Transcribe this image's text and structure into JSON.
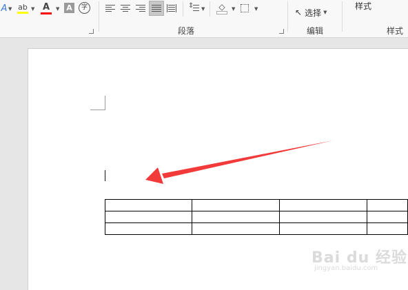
{
  "ribbon": {
    "font_group": {
      "text_effects_icon": "A",
      "highlight_icon": "ab",
      "font_color_icon": "A",
      "char_shading_icon": "A",
      "enclose_char_icon": "字"
    },
    "paragraph_group": {
      "label": "段落"
    },
    "editing_group": {
      "select_label": "选择",
      "label": "编辑"
    },
    "styles_group": {
      "gallery_label": "样式",
      "label": "样式"
    },
    "colors": {
      "highlight": "#ffff00",
      "font_color": "#ff0000"
    }
  },
  "document": {
    "table": {
      "rows": [
        [
          "",
          "",
          "",
          ""
        ],
        [
          "",
          "",
          "",
          ""
        ],
        [
          "",
          "",
          "",
          ""
        ]
      ]
    },
    "arrow_color": "#f23a3a"
  },
  "watermark": {
    "text": "Bai du 经验",
    "sub": "jingyan.baidu.com"
  }
}
